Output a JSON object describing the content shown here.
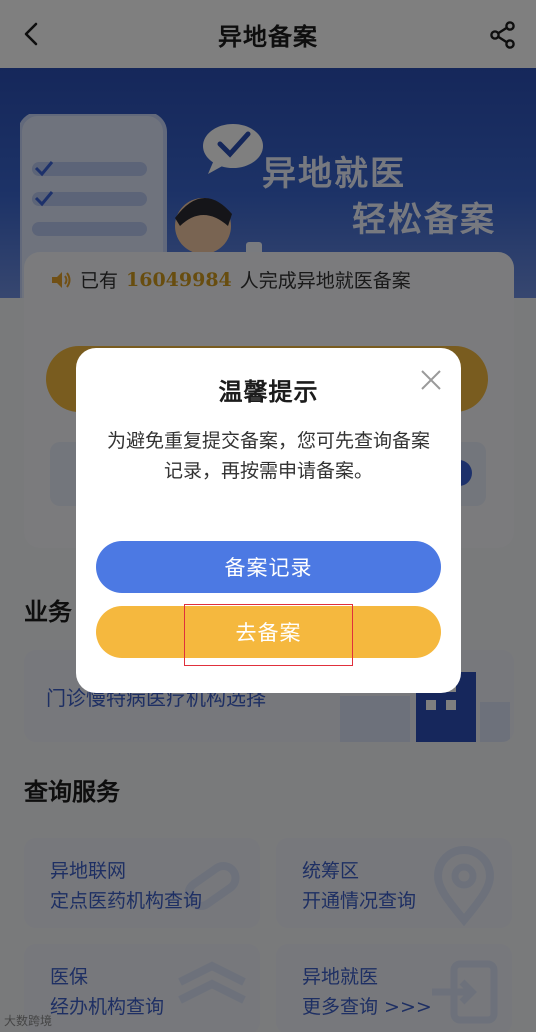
{
  "navbar": {
    "title": "异地备案",
    "back_icon": "back-chevron-icon",
    "share_icon": "share-icon"
  },
  "banner": {
    "slogan_line1": "异地就医",
    "slogan_line2": "轻松备案"
  },
  "count": {
    "prefix": "已有",
    "number": "16049984",
    "suffix": "人完成异地就医备案"
  },
  "business": {
    "title": "业务",
    "card_text": "门诊慢特病医疗机构选择"
  },
  "query": {
    "title": "查询服务",
    "cards": [
      {
        "line1": "异地联网",
        "line2": "定点医药机构查询"
      },
      {
        "line1": "统筹区",
        "line2": "开通情况查询"
      },
      {
        "line1": "医保",
        "line2": "经办机构查询"
      },
      {
        "line1": "异地就医",
        "line2": "更多查询 >>>"
      }
    ]
  },
  "watermark": "大数跨境",
  "dialog": {
    "title": "温馨提示",
    "message": "为避免重复提交备案，您可先查询备案记录，再按需申请备案。",
    "record_button": "备案记录",
    "go_button": "去备案"
  },
  "colors": {
    "primary_blue": "#4c79e3",
    "accent_yellow": "#f5b83e",
    "number_gold": "#d19a1e",
    "highlight_red": "#e0303c"
  }
}
